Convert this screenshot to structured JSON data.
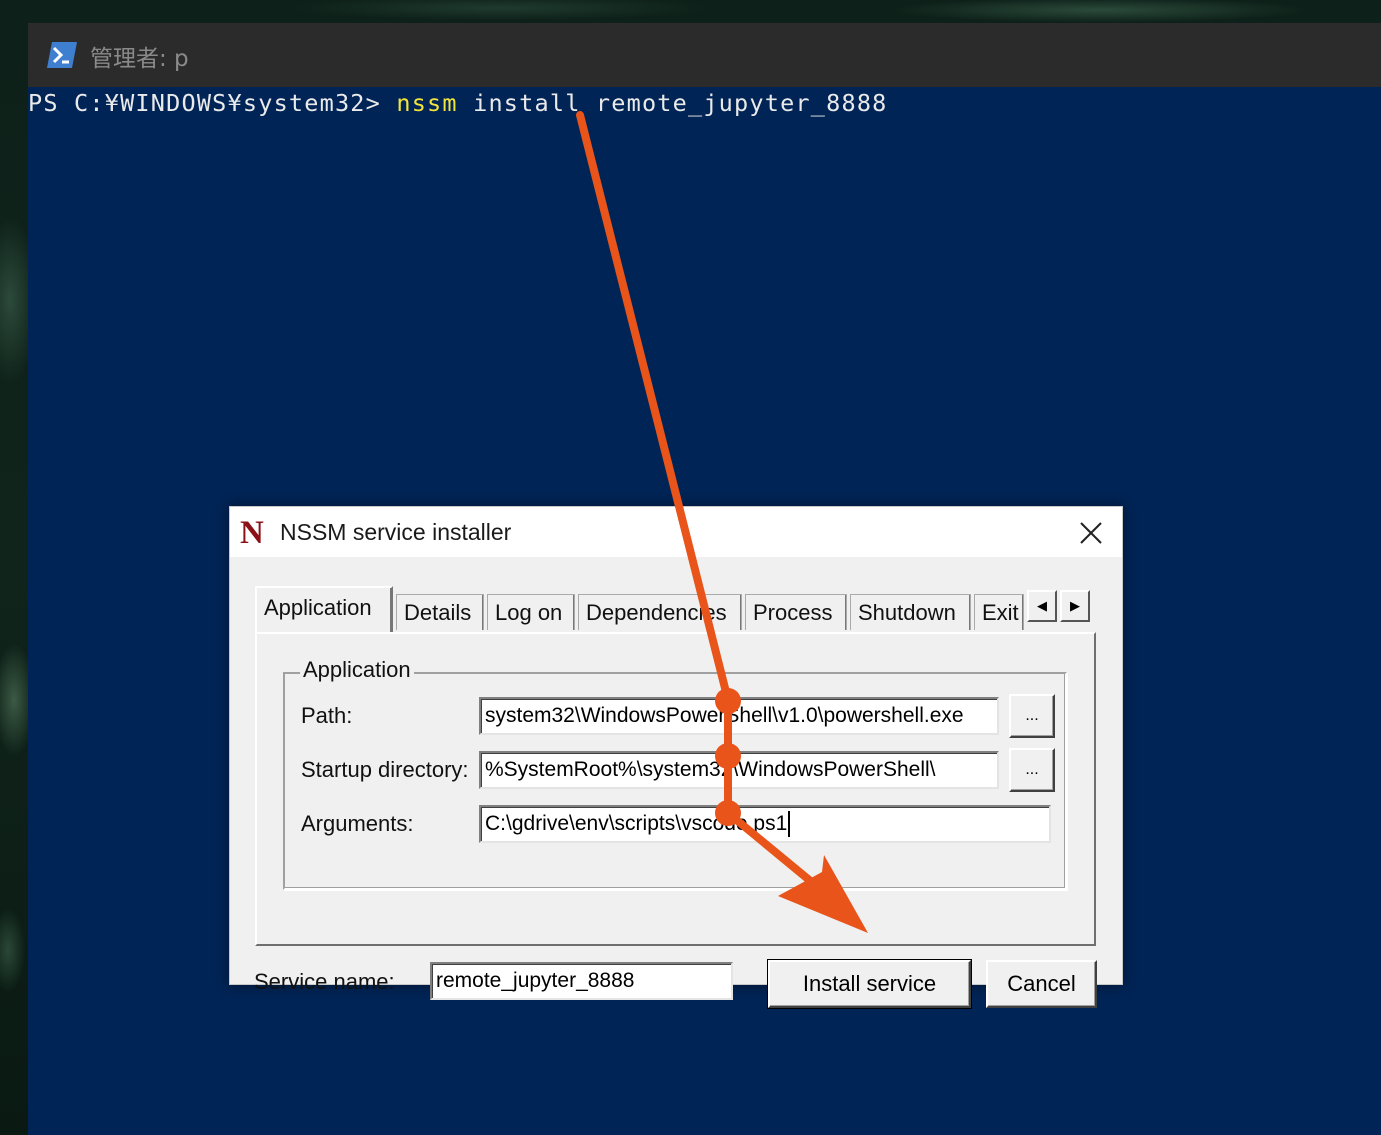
{
  "powershell": {
    "title": "管理者: p",
    "prompt": "PS C:¥WINDOWS¥system32> ",
    "command": "nssm",
    "args": " install remote_jupyter_8888",
    "background_color": "#012456",
    "icon": "powershell-icon"
  },
  "dialog": {
    "logo": "N",
    "title": "NSSM service installer",
    "close_icon": "close-icon",
    "tabs": [
      {
        "label": "Application",
        "active": true
      },
      {
        "label": "Details"
      },
      {
        "label": "Log on"
      },
      {
        "label": "Dependencies"
      },
      {
        "label": "Process"
      },
      {
        "label": "Shutdown"
      },
      {
        "label": "Exit"
      }
    ],
    "tab_scroll": {
      "left": "◀",
      "right": "▶"
    },
    "group_title": "Application",
    "fields": {
      "path": {
        "label": "Path:",
        "value": "system32\\WindowsPowerShell\\v1.0\\powershell.exe",
        "browse": "..."
      },
      "startup_dir": {
        "label": "Startup directory:",
        "value": "%SystemRoot%\\system32\\WindowsPowerShell\\",
        "browse": "..."
      },
      "arguments": {
        "label": "Arguments:",
        "value": "C:\\gdrive\\env\\scripts\\vscode.ps1"
      }
    },
    "service_name": {
      "label": "Service name:",
      "value": "remote_jupyter_8888"
    },
    "buttons": {
      "install": "Install service",
      "cancel": "Cancel"
    }
  },
  "annotation": {
    "color": "#e8541a",
    "type": "arrow"
  }
}
